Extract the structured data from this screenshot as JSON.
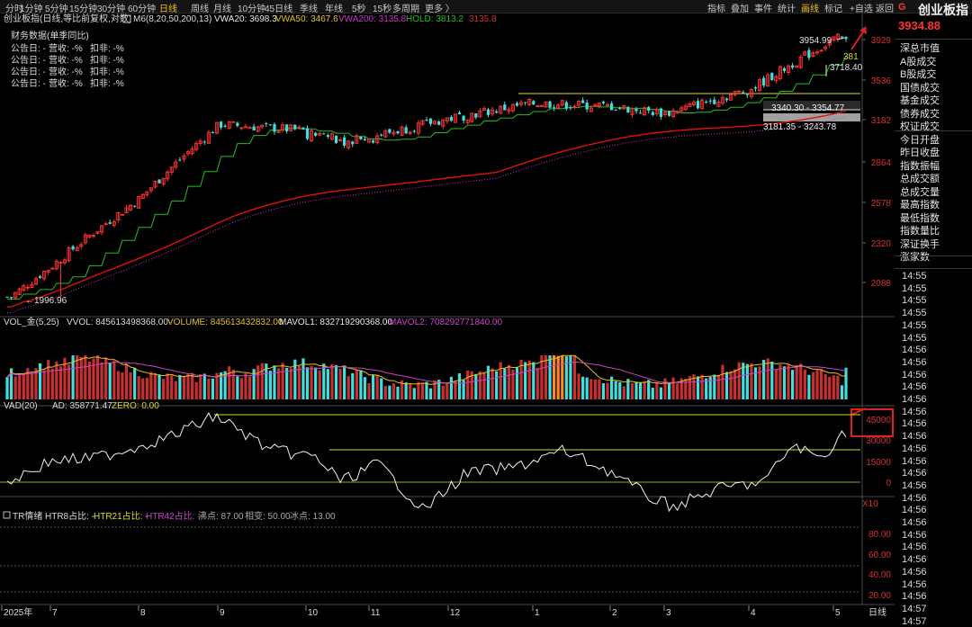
{
  "topbar": {
    "periods": [
      "分时",
      "1分钟",
      "5分钟",
      "15分钟",
      "30分钟",
      "60分钟",
      "日线",
      "周线",
      "月线",
      "10分钟",
      "45日线",
      "季线",
      "年线",
      "5秒",
      "15秒",
      "多周期",
      "更多 〉"
    ],
    "active_period": "日线",
    "tools": [
      "指标",
      "叠加",
      "事件",
      "统计",
      "画线",
      "标记"
    ],
    "active_tool": "画线",
    "add_fav": "+自选",
    "back": "返回"
  },
  "main_legend": {
    "title": "创业板指(日线,等比前复权,对数)",
    "ma": "M6(8,20,50,200,13)",
    "vwa20": "VWA20: 3698.3",
    "vwa50": "VWA50: 3467.6",
    "vwa200": "VWA200: 3135.8",
    "hold": "HOLD: 3813.2",
    "hold2": "3135.8"
  },
  "finance": {
    "title": "财务数据(单季同比)",
    "row": [
      "公告日: -",
      "营收: -%",
      "扣非: -%"
    ]
  },
  "price_axis": [
    "3929",
    "3536",
    "3182",
    "2864",
    "2578",
    "2320",
    "2088"
  ],
  "annotations": {
    "high": "3954.99",
    "low": "1996.96",
    "box1": "3340.30 - 3354.77",
    "box2": "3181.35 - 3243.78",
    "last_small": "381",
    "last2": "3718.40"
  },
  "vol_legend": {
    "title": "VOL_金(5,25)",
    "vvol": "VVOL: 845613498368.00",
    "volume": "VOLUME: 845613432832.00",
    "mavol1": "MAVOL1: 832719290368.00",
    "mavol2": "MAVOL2: 708292771840.00"
  },
  "vad_legend": {
    "title": "VAD(20)",
    "ad": "AD: 358771.47",
    "zero": "ZERO: 0.00"
  },
  "vad_axis": [
    "45000",
    "30000",
    "15000",
    "0"
  ],
  "vad_mult": "X10",
  "tr_legend": {
    "title": "TR情绪",
    "htr8": "HTR8占比: -",
    "htr21": "HTR21占比: -",
    "htr42": "HTR42占比: -",
    "boil": "沸点: 87.00",
    "phase": "相变: 50.00",
    "freeze": "冰点: 13.00"
  },
  "tr_axis": [
    "80.00",
    "60.00",
    "40.00",
    "20.00"
  ],
  "date_axis": [
    "2025年",
    "7",
    "8",
    "9",
    "10",
    "11",
    "12",
    "1",
    "2",
    "3",
    "4",
    "5"
  ],
  "date_period": "日线",
  "side": {
    "marker": "G",
    "name": "创业板指",
    "price": "3934.88",
    "items": [
      "深总市值",
      "A股成交",
      "B股成交",
      "国债成交",
      "基金成交",
      "债券成交",
      "权证成交",
      "今日开盘",
      "昨日收盘",
      "指数振幅",
      "总成交额",
      "总成交量",
      "最高指数",
      "最低指数",
      "指数量比",
      "深证换手",
      "涨家数"
    ],
    "times": [
      "14:55",
      "14:55",
      "14:55",
      "14:55",
      "14:55",
      "14:55",
      "14:56",
      "14:56",
      "14:56",
      "14:56",
      "14:56",
      "14:56",
      "14:56",
      "14:56",
      "14:56",
      "14:56",
      "14:56",
      "14:56",
      "14:56",
      "14:56",
      "14:56",
      "14:56",
      "14:56",
      "14:56",
      "14:56",
      "14:56",
      "14:56",
      "14:57",
      "14:57"
    ]
  },
  "colors": {
    "up": "#ff3333",
    "down": "#44dddd",
    "ma_green": "#22c022",
    "vwa200": "#cc33cc",
    "ma_red": "#e01010",
    "yellow": "#dcdc20",
    "vol_highlight": "#ff8822"
  },
  "chart_data": {
    "type": "candlestick",
    "title": "创业板指(日线,等比前复权,对数)",
    "scale": "log",
    "ylim": [
      2000,
      4000
    ],
    "x_months": [
      "2025年",
      "7",
      "8",
      "9",
      "10",
      "11",
      "12",
      "1",
      "2",
      "3",
      "4",
      "5"
    ],
    "high": 3954.99,
    "low": 1996.96,
    "last": 3934.88,
    "key_points": [
      {
        "month": "6",
        "close": 2010
      },
      {
        "month": "7",
        "close": 2180
      },
      {
        "month": "8",
        "close": 2600
      },
      {
        "month": "9",
        "close": 3150
      },
      {
        "month": "10",
        "close": 3100
      },
      {
        "month": "11",
        "close": 3050
      },
      {
        "month": "12",
        "close": 3200
      },
      {
        "month": "1",
        "close": 3330
      },
      {
        "month": "2",
        "close": 3300
      },
      {
        "month": "3",
        "close": 3240
      },
      {
        "month": "4",
        "close": 3450
      },
      {
        "month": "5",
        "close": 3934.88
      }
    ],
    "series": [
      {
        "name": "VWA20",
        "last": 3698.3
      },
      {
        "name": "VWA50",
        "last": 3467.6
      },
      {
        "name": "VWA200",
        "last": 3135.8
      },
      {
        "name": "HOLD",
        "last": 3813.2
      }
    ]
  }
}
